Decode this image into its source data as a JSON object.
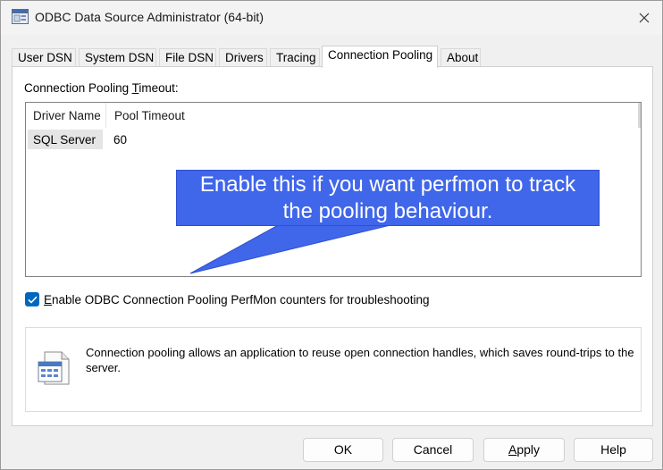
{
  "window": {
    "title": "ODBC Data Source Administrator (64-bit)"
  },
  "tabs": [
    {
      "label": "User DSN",
      "active": false
    },
    {
      "label": "System DSN",
      "active": false
    },
    {
      "label": "File DSN",
      "active": false
    },
    {
      "label": "Drivers",
      "active": false
    },
    {
      "label": "Tracing",
      "active": false
    },
    {
      "label": "Connection Pooling",
      "active": true
    },
    {
      "label": "About",
      "active": false
    }
  ],
  "pooling": {
    "timeout_label_pre": "Connection Pooling ",
    "timeout_label_accel": "T",
    "timeout_label_post": "imeout:",
    "columns": [
      "Driver Name",
      "Pool Timeout"
    ],
    "rows": [
      {
        "driver": "SQL Server",
        "timeout": "60"
      }
    ]
  },
  "callout": {
    "text_line1": "Enable this if you want perfmon to track",
    "text_line2": "the pooling behaviour.",
    "color": "#4066ea"
  },
  "perfmon": {
    "checked": true,
    "label_accel": "E",
    "label_rest": "nable ODBC Connection Pooling PerfMon counters for troubleshooting"
  },
  "info": {
    "icon": "data-sources-icon",
    "text": "Connection pooling allows an application to reuse open connection handles, which saves round-trips to the server."
  },
  "buttons": {
    "ok": "OK",
    "cancel": "Cancel",
    "apply_accel": "A",
    "apply_rest": "pply",
    "help": "Help"
  },
  "colors": {
    "accent": "#0067c0"
  }
}
